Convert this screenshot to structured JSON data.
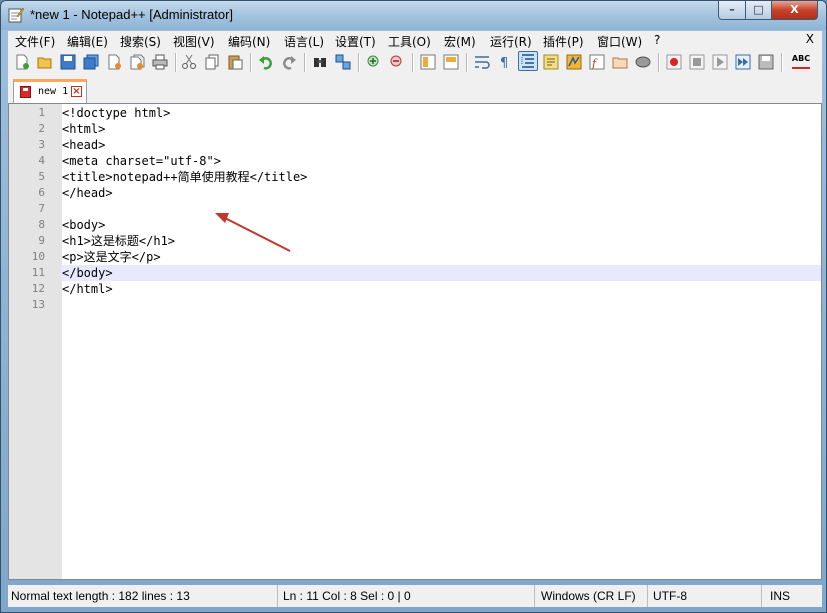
{
  "window": {
    "title": "*new 1 - Notepad++ [Administrator]",
    "buttons": {
      "minimize": "–",
      "maximize": "□",
      "close": "X"
    }
  },
  "menu": {
    "items": [
      "文件(F)",
      "编辑(E)",
      "搜索(S)",
      "视图(V)",
      "编码(N)",
      "语言(L)",
      "设置(T)",
      "工具(O)",
      "宏(M)",
      "运行(R)",
      "插件(P)",
      "窗口(W)",
      "?"
    ],
    "close": "X"
  },
  "toolbar": {
    "icons": [
      "new-file-icon",
      "open-file-icon",
      "save-icon",
      "save-all-icon",
      "close-icon",
      "close-all-icon",
      "print-icon",
      "cut-icon",
      "copy-icon",
      "paste-icon",
      "undo-icon",
      "redo-icon",
      "find-icon",
      "replace-icon",
      "zoom-in-icon",
      "zoom-out-icon",
      "sync-vertical-icon",
      "sync-horizontal-icon",
      "word-wrap-icon",
      "show-all-chars-icon",
      "indent-guide-icon",
      "user-defined-lang-icon",
      "doc-map-icon",
      "function-list-icon",
      "folder-workspace-icon",
      "monitoring-icon",
      "record-macro-icon",
      "stop-record-icon",
      "play-macro-icon",
      "run-macro-multiple-icon",
      "save-macro-icon",
      "spell-check-icon"
    ],
    "spellcheck_label": "ABC"
  },
  "tab": {
    "label": "new 1"
  },
  "editor": {
    "lines": [
      "<!doctype html>",
      "<html>",
      "<head>",
      "<meta charset=\"utf-8\">",
      "<title>notepad++简单使用教程</title>",
      "</head>",
      "",
      "<body>",
      "<h1>这是标题</h1>",
      "<p>这是文字</p>",
      "</body>",
      "</html>",
      ""
    ],
    "line_numbers": [
      "1",
      "2",
      "3",
      "4",
      "5",
      "6",
      "7",
      "8",
      "9",
      "10",
      "11",
      "12",
      "13"
    ],
    "current_line": 11
  },
  "statusbar": {
    "info": "Normal text length : 182    lines : 13",
    "position": "Ln : 11    Col : 8    Sel : 0 | 0",
    "eol": "Windows (CR LF)",
    "encoding": "UTF-8",
    "mode": "INS"
  },
  "colors": {
    "current_line": "#e8e8ff",
    "arrow": "#c0392b",
    "tab_accent": "#fca85a"
  }
}
